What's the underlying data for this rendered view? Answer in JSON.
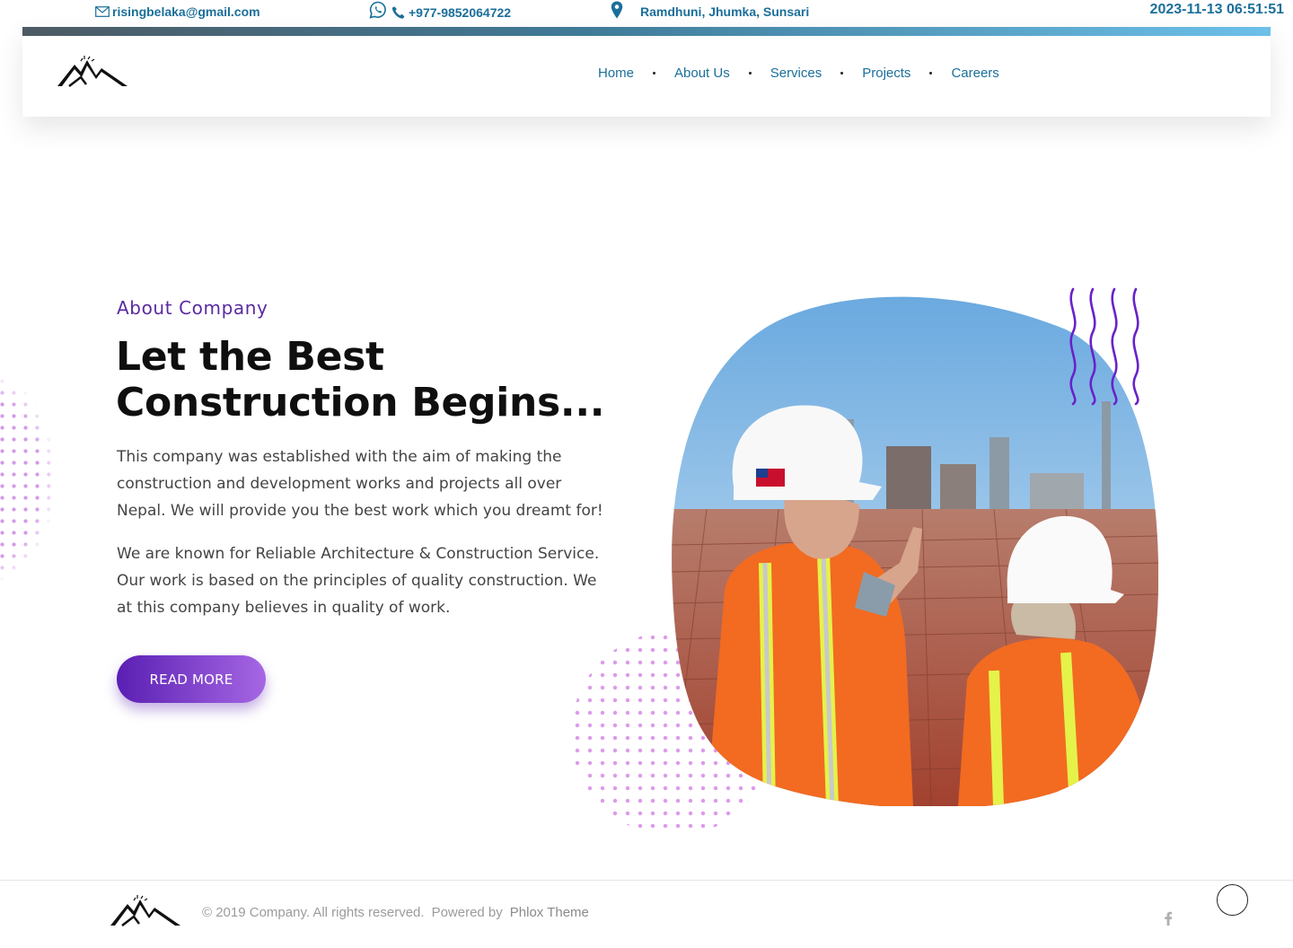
{
  "topbar": {
    "email": "risingbelaka@gmail.com",
    "phone": "+977-9852064722",
    "address": "Ramdhuni, Jhumka, Sunsari",
    "datetime": "2023-11-13 06:51:51"
  },
  "nav": {
    "items": [
      "Home",
      "About Us",
      "Services",
      "Projects",
      "Careers"
    ]
  },
  "hero": {
    "eyebrow": "About Company",
    "headline": "Let the Best Construction Begins...",
    "paragraph_1": "This company was established with the aim of making the construction and development works and projects all over Nepal. We will provide you the best work which you dreamt for!",
    "paragraph_2": "We are known for Reliable Architecture & Construction Service. Our work is based on the principles of quality construction. We at this company believes in quality of work.",
    "button_label": "READ MORE",
    "image_subject": "construction-workers-hardhats-site-photo"
  },
  "footer": {
    "copyright": "© 2019 Company. All rights reserved.",
    "powered_by": "Powered by",
    "theme": "Phlox Theme",
    "social": [
      "facebook-icon"
    ]
  },
  "colors": {
    "link_blue": "#1b6f9a",
    "accent_purple": "#5a1fb3",
    "accent_purple_light": "#a667e4",
    "dots_pink": "#dc9bea"
  },
  "icons": [
    "envelope-icon",
    "whatsapp-icon",
    "phone-icon",
    "map-pin-icon",
    "mountain-logo",
    "wave-lines-decoration",
    "facebook-icon",
    "scroll-top-button"
  ]
}
